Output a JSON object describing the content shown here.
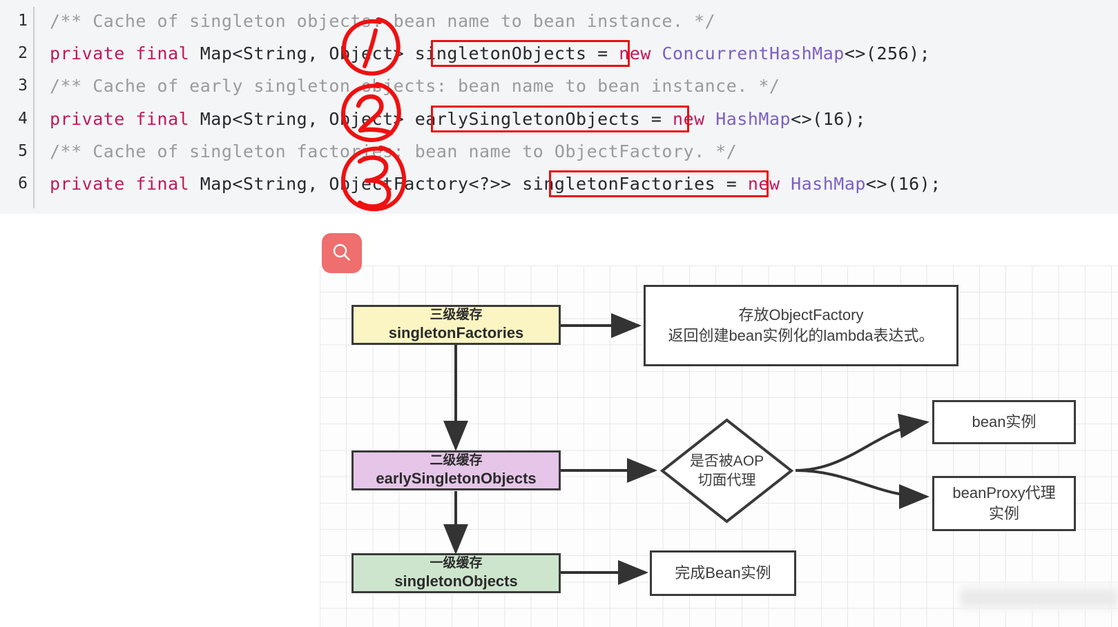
{
  "code": {
    "language": "java",
    "lines": [
      {
        "num": "1",
        "tokens": [
          {
            "t": "/** Cache of singleton objects: bean name to bean instance. */",
            "c": "com"
          }
        ]
      },
      {
        "num": "2",
        "tokens": [
          {
            "t": "private final ",
            "c": "kw"
          },
          {
            "t": "Map<String, Object> singletonObjects ",
            "c": "txt"
          },
          {
            "t": "= ",
            "c": "txt"
          },
          {
            "t": "new ",
            "c": "kw"
          },
          {
            "t": "ConcurrentHashMap",
            "c": "cls"
          },
          {
            "t": "<>(256);",
            "c": "txt"
          }
        ]
      },
      {
        "num": "3",
        "tokens": [
          {
            "t": "/** Cache of early singleton objects: bean name to bean instance. */",
            "c": "com"
          }
        ]
      },
      {
        "num": "4",
        "tokens": [
          {
            "t": "private final ",
            "c": "kw"
          },
          {
            "t": "Map<String, Object> earlySingletonObjects ",
            "c": "txt"
          },
          {
            "t": "= ",
            "c": "txt"
          },
          {
            "t": "new ",
            "c": "kw"
          },
          {
            "t": "HashMap",
            "c": "cls"
          },
          {
            "t": "<>(16);",
            "c": "txt"
          }
        ]
      },
      {
        "num": "5",
        "tokens": [
          {
            "t": "/** Cache of singleton factories: bean name to ObjectFactory. */",
            "c": "com"
          }
        ]
      },
      {
        "num": "6",
        "tokens": [
          {
            "t": "private final ",
            "c": "kw"
          },
          {
            "t": "Map<String, ObjectFactory<?>> singletonFactories ",
            "c": "txt"
          },
          {
            "t": "= ",
            "c": "txt"
          },
          {
            "t": "new ",
            "c": "kw"
          },
          {
            "t": "HashMap",
            "c": "cls"
          },
          {
            "t": "<>(16);",
            "c": "txt"
          }
        ]
      }
    ],
    "highlight_color": "#e81010",
    "highlighted_identifiers": [
      "singletonObjects",
      "earlySingletonObjects",
      "singletonFactories"
    ],
    "annotations": [
      {
        "label": "1",
        "target": "Object (line 2)"
      },
      {
        "label": "2",
        "target": "Object (line 4)"
      },
      {
        "label": "3",
        "target": "ObjectFactory (line 6)"
      }
    ]
  },
  "diagram": {
    "search_icon": "search-icon",
    "colors": {
      "level3": "#faf5c3",
      "level2": "#e5c5e8",
      "level1": "#cde5cd",
      "border": "#3a3a3a",
      "badge": "#ef6e6e"
    },
    "nodes": {
      "level3": {
        "title": "三级缓存",
        "name": "singletonFactories"
      },
      "level2": {
        "title": "二级缓存",
        "name": "earlySingletonObjects"
      },
      "level1": {
        "title": "一级缓存",
        "name": "singletonObjects"
      },
      "factory_note": {
        "line1": "存放ObjectFactory",
        "line2": "返回创建bean实例化的lambda表达式。"
      },
      "decision": {
        "line1": "是否被AOP",
        "line2": "切面代理"
      },
      "bean_instance": {
        "line1": "bean实例"
      },
      "bean_proxy": {
        "line1": "beanProxy代理",
        "line2": "实例"
      },
      "finish": {
        "line1": "完成Bean实例"
      }
    }
  }
}
